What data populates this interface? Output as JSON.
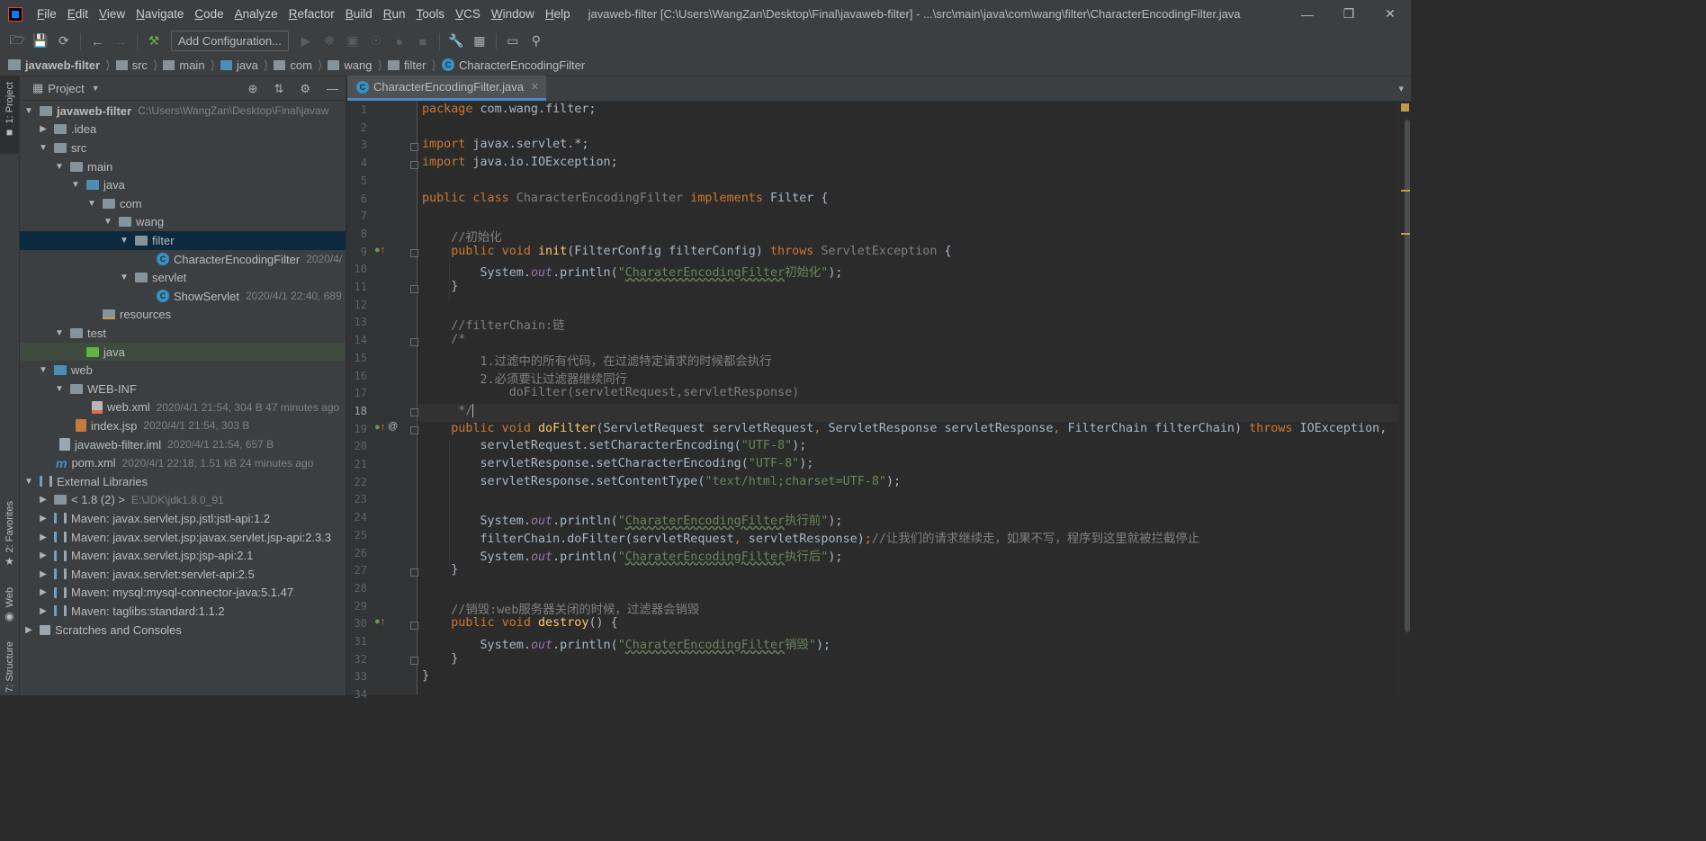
{
  "menubar": {
    "items": [
      "File",
      "Edit",
      "View",
      "Navigate",
      "Code",
      "Analyze",
      "Refactor",
      "Build",
      "Run",
      "Tools",
      "VCS",
      "Window",
      "Help"
    ],
    "window_title": "javaweb-filter [C:\\Users\\WangZan\\Desktop\\Final\\javaweb-filter] - ...\\src\\main\\java\\com\\wang\\filter\\CharacterEncodingFilter.java",
    "controls": [
      "minimize",
      "restore",
      "close"
    ]
  },
  "toolbar": {
    "run_config_label": "Add Configuration...",
    "icons": [
      "open-folder-icon",
      "save-icon",
      "sync-icon",
      "back-arrow-icon",
      "forward-arrow-icon",
      "build-hammer-icon",
      "run-icon",
      "debug-icon",
      "coverage-icon",
      "profile-icon",
      "attach-icon",
      "stop-icon",
      "settings-wrench-icon",
      "project-structure-icon",
      "terminal-icon",
      "search-icon"
    ]
  },
  "breadcrumb": {
    "project": "javaweb-filter",
    "items": [
      "src",
      "main",
      "java",
      "com",
      "wang",
      "filter"
    ],
    "current": "CharacterEncodingFilter"
  },
  "left_stripe": {
    "project_tab": "1: Project",
    "favorites_tab": "2: Favorites",
    "web_tab": "Web",
    "structure_tab": "7: Structure"
  },
  "project_panel": {
    "title": "Project",
    "tree": [
      {
        "name": "javaweb-filter",
        "meta": "C:\\Users\\WangZan\\Desktop\\Final\\javaw",
        "bold": true
      },
      {
        "name": ".idea",
        "meta": ""
      },
      {
        "name": "src",
        "meta": ""
      },
      {
        "name": "main",
        "meta": ""
      },
      {
        "name": "java",
        "meta": ""
      },
      {
        "name": "com",
        "meta": ""
      },
      {
        "name": "wang",
        "meta": ""
      },
      {
        "name": "filter",
        "meta": ""
      },
      {
        "name": "CharacterEncodingFilter",
        "meta": "2020/4/"
      },
      {
        "name": "servlet",
        "meta": ""
      },
      {
        "name": "ShowServlet",
        "meta": "2020/4/1 22:40, 689"
      },
      {
        "name": "resources",
        "meta": ""
      },
      {
        "name": "test",
        "meta": ""
      },
      {
        "name": "java",
        "meta": ""
      },
      {
        "name": "web",
        "meta": ""
      },
      {
        "name": "WEB-INF",
        "meta": ""
      },
      {
        "name": "web.xml",
        "meta": "2020/4/1 21:54, 304 B 47 minutes ago"
      },
      {
        "name": "index.jsp",
        "meta": "2020/4/1 21:54, 303 B"
      },
      {
        "name": "javaweb-filter.iml",
        "meta": "2020/4/1 21:54, 657 B"
      },
      {
        "name": "pom.xml",
        "meta": "2020/4/1 22:18, 1.51 kB 24 minutes ago"
      },
      {
        "name": "External Libraries",
        "meta": ""
      },
      {
        "name": "< 1.8 (2) >",
        "meta": "E:\\JDK\\jdk1.8.0_91"
      },
      {
        "name": "Maven: javax.servlet.jsp.jstl:jstl-api:1.2",
        "meta": ""
      },
      {
        "name": "Maven: javax.servlet.jsp:javax.servlet.jsp-api:2.3.3",
        "meta": ""
      },
      {
        "name": "Maven: javax.servlet.jsp:jsp-api:2.1",
        "meta": ""
      },
      {
        "name": "Maven: javax.servlet:servlet-api:2.5",
        "meta": ""
      },
      {
        "name": "Maven: mysql:mysql-connector-java:5.1.47",
        "meta": ""
      },
      {
        "name": "Maven: taglibs:standard:1.1.2",
        "meta": ""
      },
      {
        "name": "Scratches and Consoles",
        "meta": ""
      }
    ]
  },
  "editor": {
    "tab_label": "CharacterEncodingFilter.java",
    "current_line": 18,
    "line_numbers": [
      "1",
      "2",
      "3",
      "4",
      "5",
      "6",
      "7",
      "8",
      "9",
      "10",
      "11",
      "12",
      "13",
      "14",
      "15",
      "16",
      "17",
      "18",
      "19",
      "20",
      "21",
      "22",
      "23",
      "24",
      "25",
      "26",
      "27",
      "28",
      "29",
      "30",
      "31",
      "32",
      "33",
      "34"
    ],
    "code": {
      "l1a": "package",
      "l1b": " com.wang.filter;",
      "l3a": "import",
      "l3b": " javax.servlet.*;",
      "l4a": "import",
      "l4b": " java.io.IOException;",
      "l6a": "public class",
      "l6b": " CharacterEncodingFilter ",
      "l6c": "implements",
      "l6d": " Filter {",
      "l8": "    //初始化",
      "l9a": "    public void ",
      "l9b": "init",
      "l9c": "(FilterConfig filterConfig) ",
      "l9d": "throws",
      "l9e": " ServletException",
      "l9f": " {",
      "l10a": "        System.",
      "l10b": "out",
      "l10c": ".println(",
      "l10d": "\"",
      "l10e": "CharaterEncodingFilter",
      "l10f": "初始化\"",
      "l10g": ");",
      "l11": "    }",
      "l13": "    //filterChain:链",
      "l14": "    /*",
      "l15": "        1.过滤中的所有代码，在过滤特定请求的时候都会执行",
      "l16": "        2.必须要让过滤器继续同行",
      "l17": "            doFilter(servletRequest,servletResponse)",
      "l18": "     */",
      "l19a": "    public void ",
      "l19b": "doFilter",
      "l19c": "(ServletRequest servletRequest",
      "l19d": ",",
      "l19e": " ServletResponse servletResponse",
      "l19f": ",",
      "l19g": " FilterChain filterChain) ",
      "l19h": "throws",
      "l19i": " IOException,",
      "l20a": "        servletRequest.setCharacterEncoding(",
      "l20b": "\"UTF-8\"",
      "l20c": ");",
      "l21a": "        servletResponse.setCharacterEncoding(",
      "l21b": "\"UTF-8\"",
      "l21c": ");",
      "l22a": "        servletResponse.setContentType(",
      "l22b": "\"text/html;charset=UTF-8\"",
      "l22c": ");",
      "l24a": "        System.",
      "l24b": "out",
      "l24c": ".println(",
      "l24d": "\"",
      "l24e": "CharaterEncodingFilter",
      "l24f": "执行前\"",
      "l24g": ");",
      "l25a": "        filterChain.doFilter(servletRequest",
      "l25b": ",",
      "l25c": " servletResponse)",
      "l25d": ";",
      "l25e": "//让我们的请求继续走，如果不写，程序到这里就被拦截停止",
      "l26a": "        System.",
      "l26b": "out",
      "l26c": ".println(",
      "l26d": "\"",
      "l26e": "CharaterEncodingFilter",
      "l26f": "执行后\"",
      "l26g": ");",
      "l27": "    }",
      "l29": "    //销毁:web服务器关闭的时候，过滤器会销毁",
      "l30a": "    public void ",
      "l30b": "destroy",
      "l30c": "() {",
      "l31a": "        System.",
      "l31b": "out",
      "l31c": ".println(",
      "l31d": "\"",
      "l31e": "CharaterEncodingFilter",
      "l31f": "销毁\"",
      "l31g": ");",
      "l32": "    }",
      "l33": "}"
    }
  },
  "colors": {
    "keyword": "#cc7832",
    "string": "#6a8759",
    "comment": "#808080",
    "method": "#ffc66d",
    "static_field": "#9876aa",
    "text": "#a9b7c6",
    "selection": "#0d293e",
    "background": "#2b2b2b"
  }
}
